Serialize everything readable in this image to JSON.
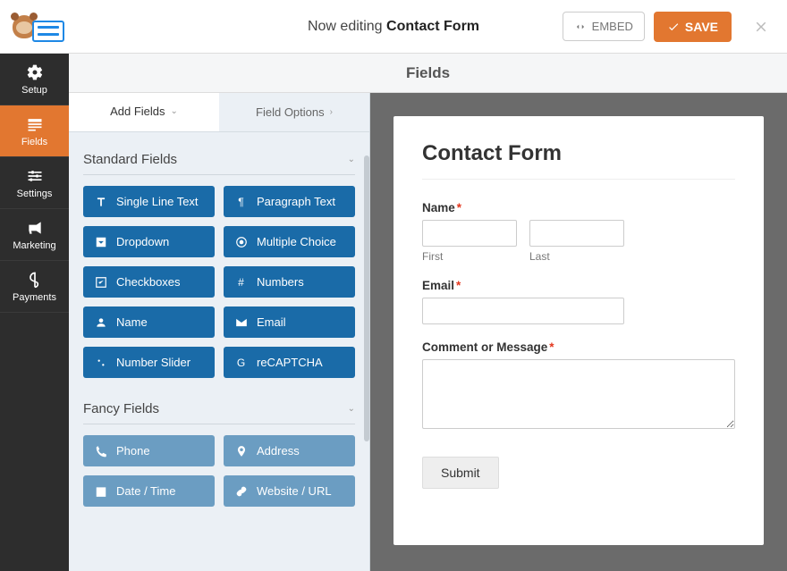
{
  "topbar": {
    "editing_prefix": "Now editing ",
    "form_name": "Contact Form",
    "embed_label": "EMBED",
    "save_label": "SAVE"
  },
  "nav": {
    "setup": "Setup",
    "fields": "Fields",
    "settings": "Settings",
    "marketing": "Marketing",
    "payments": "Payments"
  },
  "panel_title": "Fields",
  "tabs": {
    "add": "Add Fields",
    "options": "Field Options"
  },
  "sections": {
    "standard": {
      "title": "Standard Fields",
      "items": [
        {
          "label": "Single Line Text"
        },
        {
          "label": "Paragraph Text"
        },
        {
          "label": "Dropdown"
        },
        {
          "label": "Multiple Choice"
        },
        {
          "label": "Checkboxes"
        },
        {
          "label": "Numbers"
        },
        {
          "label": "Name"
        },
        {
          "label": "Email"
        },
        {
          "label": "Number Slider"
        },
        {
          "label": "reCAPTCHA"
        }
      ]
    },
    "fancy": {
      "title": "Fancy Fields",
      "items": [
        {
          "label": "Phone"
        },
        {
          "label": "Address"
        },
        {
          "label": "Date / Time"
        },
        {
          "label": "Website / URL"
        }
      ]
    }
  },
  "preview": {
    "title": "Contact Form",
    "name_label": "Name",
    "first": "First",
    "last": "Last",
    "email_label": "Email",
    "comment_label": "Comment or Message",
    "submit": "Submit",
    "required_marker": "*"
  }
}
